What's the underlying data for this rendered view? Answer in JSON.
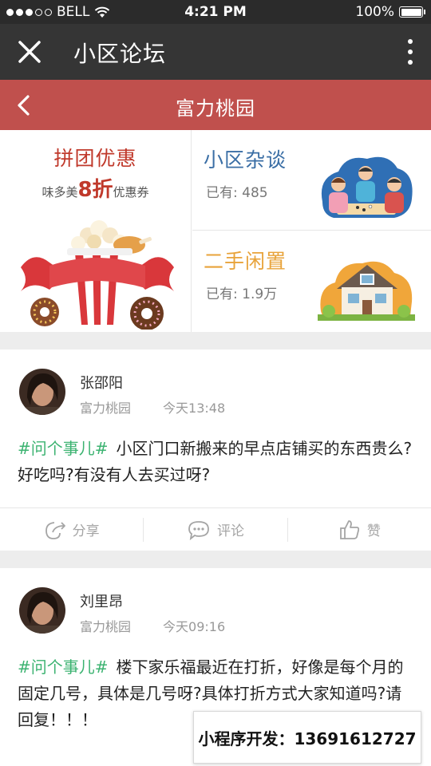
{
  "status_bar": {
    "carrier": "BELL",
    "time": "4:21 PM",
    "battery": "100%",
    "battery_level": 1.0
  },
  "app_bar": {
    "title": "小区论坛"
  },
  "nav_bar": {
    "title": "富力桃园"
  },
  "banner": {
    "group_buy": {
      "title": "拼团优惠",
      "brand": "味多美",
      "discount": "8折",
      "coupon": "优惠券"
    },
    "chat": {
      "title": "小区杂谈",
      "count_label": "已有:",
      "count": "485"
    },
    "secondhand": {
      "title": "二手闲置",
      "count_label": "已有:",
      "count": "1.9万"
    }
  },
  "posts": [
    {
      "author": "张邵阳",
      "community": "富力桃园",
      "time": "今天13:48",
      "tag": "#问个事儿#",
      "text": "小区门口新搬来的早点店铺买的东西贵么?好吃吗?有没有人去买过呀?",
      "actions": {
        "share": "分享",
        "comment": "评论",
        "like": "赞"
      }
    },
    {
      "author": "刘里昂",
      "community": "富力桃园",
      "time": "今天09:16",
      "tag": "#问个事儿#",
      "text": "楼下家乐福最近在打折，好像是每个月的固定几号，具体是几号呀?具体打折方式大家知道吗?请回复！！！"
    }
  ],
  "promo": {
    "text": "小程序开发：13691612727"
  },
  "colors": {
    "accent_red": "#c0504d",
    "tag_green": "#3cb371",
    "chat_blue": "#3a6ea5",
    "secondhand_orange": "#e8a33a"
  }
}
